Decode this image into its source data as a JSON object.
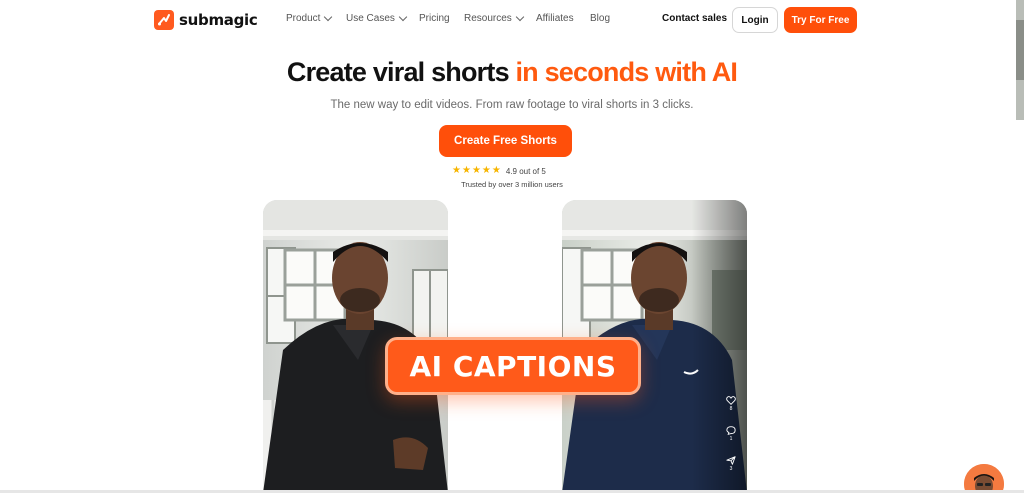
{
  "nav": {
    "logo_text": "submagic",
    "menu": [
      {
        "label": "Product",
        "has_dropdown": true
      },
      {
        "label": "Use Cases",
        "has_dropdown": true
      },
      {
        "label": "Pricing",
        "has_dropdown": false
      },
      {
        "label": "Resources",
        "has_dropdown": true
      },
      {
        "label": "Affiliates",
        "has_dropdown": false
      },
      {
        "label": "Blog",
        "has_dropdown": false
      }
    ],
    "contact_label": "Contact sales",
    "login_label": "Login",
    "try_label": "Try For Free"
  },
  "hero": {
    "title_main": "Create viral shorts ",
    "title_accent": "in seconds with AI",
    "subtitle": "The new way to edit videos. From raw footage to viral shorts in 3 clicks.",
    "cta_label": "Create Free Shorts",
    "rating_text": "4.9 out of 5",
    "stars": 5,
    "trusted_text": "Trusted by over 3 million users"
  },
  "demo": {
    "caption_text": "AI CAPTIONS",
    "side_counts": [
      "8",
      "1",
      "3"
    ]
  },
  "colors": {
    "accent": "#ff5a0f",
    "button": "#ff4f0a",
    "star": "#f7b500"
  },
  "icons": [
    "logo-icon",
    "chevron-down-icon",
    "star-icon",
    "heart-icon",
    "comment-icon",
    "share-icon",
    "chat-avatar-icon"
  ]
}
